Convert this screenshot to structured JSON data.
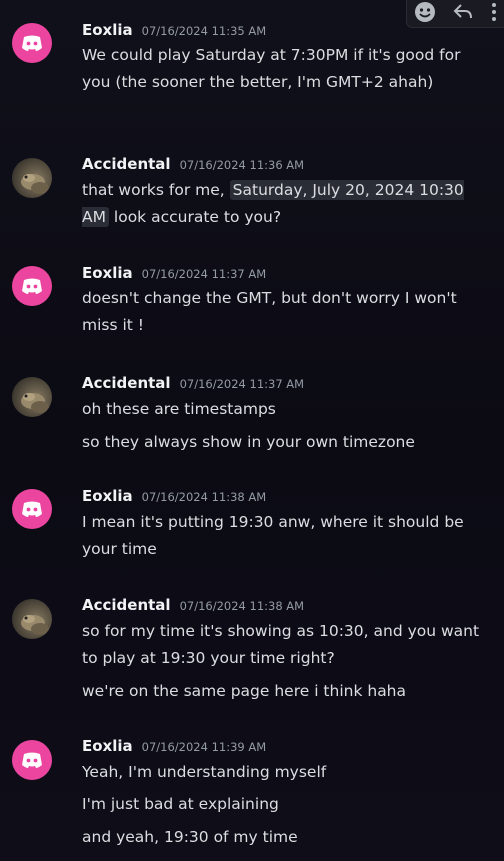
{
  "toolbar": {
    "icons": [
      "emoji-icon",
      "reply-icon",
      "more-icon"
    ]
  },
  "messages": [
    {
      "author": "Eoxlia",
      "avatar": "discord-icon",
      "time": "07/16/2024 11:35 AM",
      "lines": [
        "We could play Saturday at 7:30PM if it's good for you (the sooner the better, I'm GMT+2 ahah)"
      ]
    },
    {
      "author": "Accidental",
      "avatar": "lizard-photo",
      "time": "07/16/2024 11:36 AM",
      "lines": [
        {
          "before": "that works for me, ",
          "timestamp": "Saturday, July 20, 2024 10:30 AM",
          "after": " look accurate to you?"
        }
      ]
    },
    {
      "author": "Eoxlia",
      "avatar": "discord-icon",
      "time": "07/16/2024 11:37 AM",
      "lines": [
        "doesn't change the GMT, but don't worry I won't miss it !"
      ]
    },
    {
      "author": "Accidental",
      "avatar": "lizard-photo",
      "time": "07/16/2024 11:37 AM",
      "lines": [
        "oh these are timestamps",
        "so they always show in your own timezone"
      ]
    },
    {
      "author": "Eoxlia",
      "avatar": "discord-icon",
      "time": "07/16/2024 11:38 AM",
      "lines": [
        "I mean it's putting 19:30 anw, where it should be your time"
      ]
    },
    {
      "author": "Accidental",
      "avatar": "lizard-photo",
      "time": "07/16/2024 11:38 AM",
      "lines": [
        "so for my time it's showing as 10:30, and you want to play at 19:30 your time right?",
        "we're on the same page here i think haha"
      ]
    },
    {
      "author": "Eoxlia",
      "avatar": "discord-icon",
      "time": "07/16/2024 11:39 AM",
      "lines": [
        "Yeah, I'm understanding myself",
        "I'm just bad at explaining",
        "and yeah, 19:30 of my time"
      ]
    }
  ],
  "colors": {
    "background": "#0e0d17",
    "discord_avatar": "#eb459f",
    "author": "#f2f3f5",
    "timestamp": "#949ba4",
    "text": "#dbdee1",
    "timestamp_chip": "#2b2d36"
  }
}
